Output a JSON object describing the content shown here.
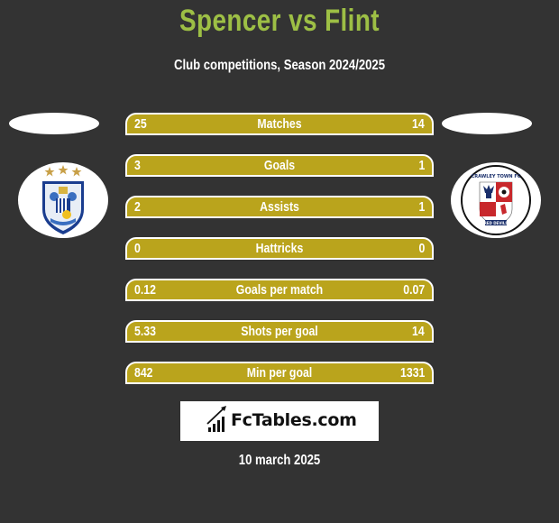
{
  "header": {
    "title": "Spencer vs Flint",
    "subtitle": "Club competitions, Season 2024/2025"
  },
  "teams": {
    "left": {
      "badge_icon": "huddersfield-crest-icon"
    },
    "right": {
      "badge_icon": "crawley-town-crest-icon",
      "badge_text_top": "CRAWLEY TOWN FC",
      "badge_text_bottom": "RED DEVILS"
    }
  },
  "stats": [
    {
      "label": "Matches",
      "left": "25",
      "right": "14"
    },
    {
      "label": "Goals",
      "left": "3",
      "right": "1"
    },
    {
      "label": "Assists",
      "left": "2",
      "right": "1"
    },
    {
      "label": "Hattricks",
      "left": "0",
      "right": "0"
    },
    {
      "label": "Goals per match",
      "left": "0.12",
      "right": "0.07"
    },
    {
      "label": "Shots per goal",
      "left": "5.33",
      "right": "14"
    },
    {
      "label": "Min per goal",
      "left": "842",
      "right": "1331"
    }
  ],
  "footer": {
    "logo_text": "FcTables.com",
    "logo_icon": "bar-chart-icon",
    "date": "10 march 2025"
  },
  "colors": {
    "background": "#333333",
    "title": "#9dbf45",
    "bar": "#baa41c",
    "text": "#ffffff"
  }
}
